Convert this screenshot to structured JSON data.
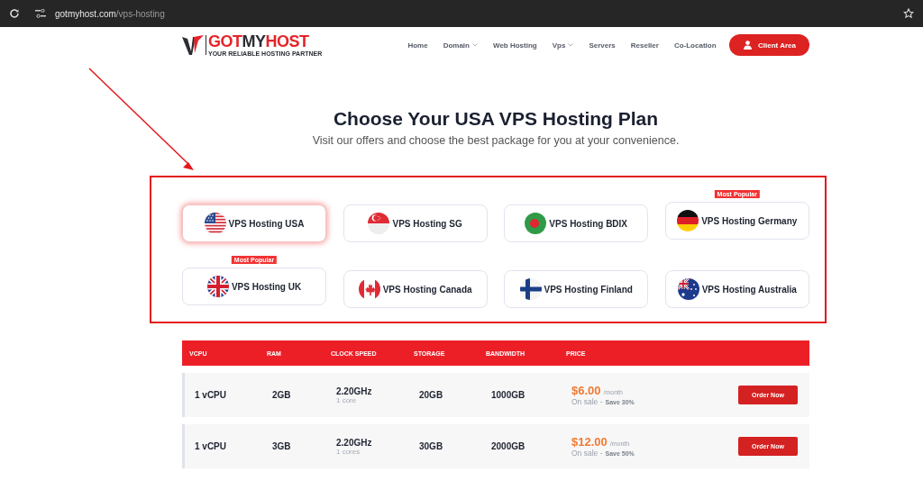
{
  "browser": {
    "url_host": "gotmyhost.com",
    "url_path": "/vps-hosting"
  },
  "header": {
    "logo": {
      "parts": [
        {
          "text": "GOT",
          "accent": true
        },
        {
          "text": "MY",
          "accent": false
        },
        {
          "text": "HOST",
          "accent": true
        }
      ],
      "tagline": "YOUR RELIABLE HOSTING PARTNER"
    },
    "nav": [
      {
        "label": "Home",
        "has_menu": false
      },
      {
        "label": "Domain",
        "has_menu": true
      },
      {
        "label": "Web Hosting",
        "has_menu": false
      },
      {
        "label": "Vps",
        "has_menu": true
      },
      {
        "label": "Servers",
        "has_menu": false
      },
      {
        "label": "Reseller",
        "has_menu": false
      },
      {
        "label": "Co-Location",
        "has_menu": false
      }
    ],
    "client_button": "Client Area"
  },
  "title": "Choose Your USA VPS Hosting Plan",
  "subtitle": "Visit our offers and choose the best package for you at your convenience.",
  "locations": [
    {
      "label": "VPS Hosting USA",
      "kind": "us",
      "selected": true
    },
    {
      "label": "VPS Hosting SG",
      "kind": "sg",
      "selected": false
    },
    {
      "label": "VPS Hosting BDIX",
      "kind": "bd",
      "selected": false
    },
    {
      "label": "VPS Hosting Germany",
      "kind": "de",
      "selected": false,
      "badge": "Most Popular"
    },
    {
      "label": "VPS Hosting UK",
      "kind": "uk",
      "selected": false,
      "badge": "Most Popular"
    },
    {
      "label": "VPS Hosting Canada",
      "kind": "ca",
      "selected": false
    },
    {
      "label": "VPS Hosting Finland",
      "kind": "fi",
      "selected": false
    },
    {
      "label": "VPS Hosting Australia",
      "kind": "au",
      "selected": false
    }
  ],
  "table": {
    "columns": [
      "VCPU",
      "RAM",
      "CLOCK SPEED",
      "STORAGE",
      "BANDWIDTH",
      "PRICE"
    ],
    "rows": [
      {
        "vcpu": "1 vCPU",
        "ram": "2GB",
        "clock": "2.20GHz",
        "cores": "1 core",
        "storage": "20GB",
        "bandwidth": "1000GB",
        "price": "$6.00",
        "period": "/month",
        "sale": "On sale -",
        "save": "Save 30%",
        "button": "Order Now"
      },
      {
        "vcpu": "1 vCPU",
        "ram": "3GB",
        "clock": "2.20GHz",
        "cores": "1 cores",
        "storage": "30GB",
        "bandwidth": "2000GB",
        "price": "$12.00",
        "period": "/month",
        "sale": "On sale -",
        "save": "Save 50%",
        "button": "Order Now"
      }
    ]
  }
}
